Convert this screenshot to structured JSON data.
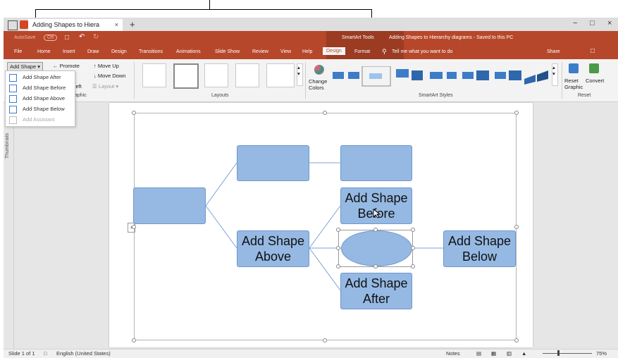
{
  "tab": {
    "title": "Adding Shapes to Hiera",
    "close": "×",
    "new": "+"
  },
  "window": {
    "minimize": "−",
    "maximize": "□",
    "close": "×"
  },
  "qat": {
    "autosave": "AutoSave",
    "toggle": "Off"
  },
  "ribbon": {
    "contextual": "SmartArt Tools",
    "doc_title": "Adding Shapes to Hierarchy diagrams  -  Saved to this PC",
    "tabs": [
      "File",
      "Home",
      "Insert",
      "Draw",
      "Design",
      "Transitions",
      "Animations",
      "Slide Show",
      "Review",
      "View",
      "Help",
      "Design",
      "Format"
    ],
    "active_tab": "Design",
    "tell_me": "Tell me what you want to do",
    "share": "Share",
    "create_graphic": {
      "add_shape": "Add Shape",
      "promote": "Promote",
      "demote": "te",
      "move_up": "Move Up",
      "move_down": "Move Down",
      "right_to_left": "to Left",
      "layout": "Layout",
      "label": "aphic"
    },
    "layouts_label": "Layouts",
    "change_colors": "Change Colors",
    "smartart_styles_label": "SmartArt Styles",
    "reset_graphic": "Reset Graphic",
    "convert": "Convert",
    "reset_label": "Reset"
  },
  "add_shape_menu": [
    {
      "label": "Add Shape After",
      "enabled": true
    },
    {
      "label": "Add Shape Before",
      "enabled": true
    },
    {
      "label": "Add Shape Above",
      "enabled": true
    },
    {
      "label": "Add Shape Below",
      "enabled": true
    },
    {
      "label": "Add Assistant",
      "enabled": false
    }
  ],
  "thumbnails_label": "Thumbnails",
  "diagram": {
    "before": "Add Shape Before",
    "above": "Add Shape Above",
    "below": "Add Shape Below",
    "after": "Add Shape After"
  },
  "status": {
    "slide": "Slide 1 of 1",
    "language": "English (United States)",
    "notes": "Notes",
    "zoom": "75%"
  },
  "colors": {
    "accent": "#b7472a",
    "shape_fill": "#95b9e3",
    "shape_border": "#6f97cc"
  }
}
